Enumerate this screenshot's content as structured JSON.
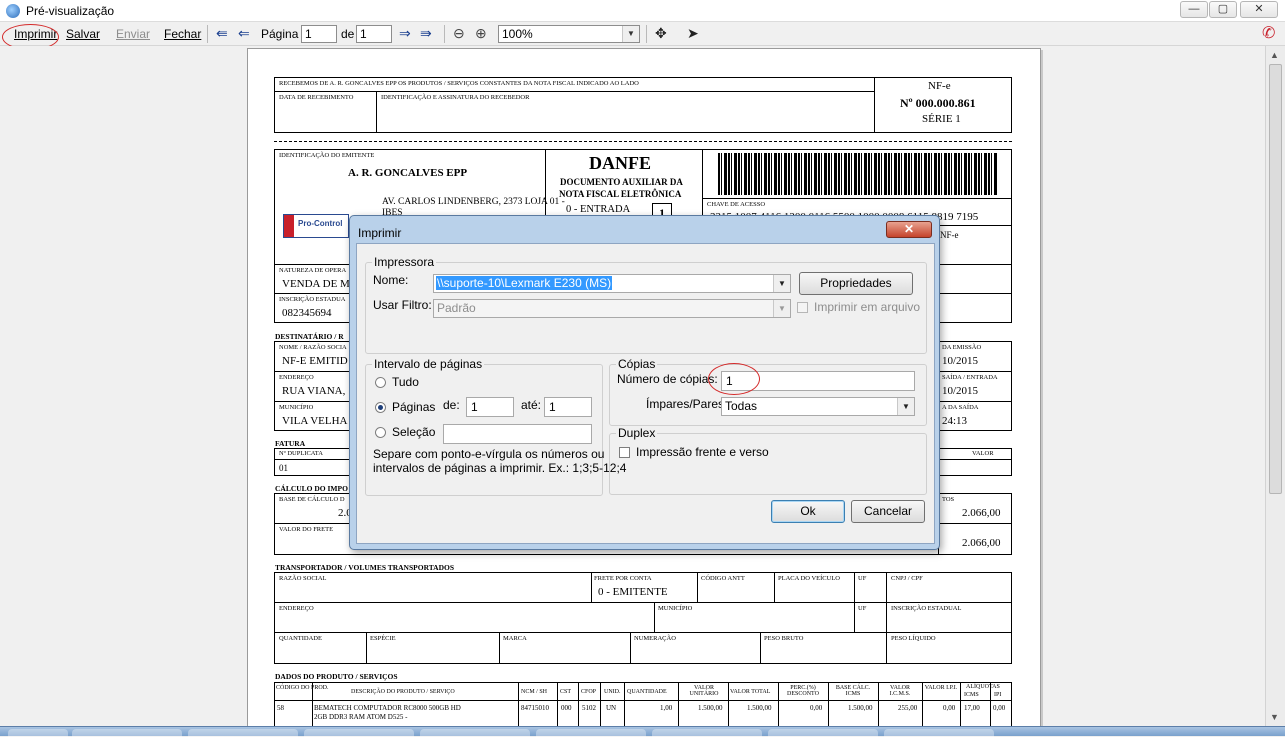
{
  "window": {
    "title": "Pré-visualização"
  },
  "toolbar": {
    "print": "Imprimir",
    "save": "Salvar",
    "send": "Enviar",
    "close": "Fechar",
    "page_label": "Página",
    "page_value": "1",
    "of_label": "de",
    "total_pages": "1",
    "zoom": "100%"
  },
  "danfe": {
    "receipt_text": "RECEBEMOS DE A. R. GONCALVES EPP OS PRODUTOS / SERVIÇOS CONSTANTES DA NOTA FISCAL INDICADO AO LADO",
    "receipt_date_label": "DATA DE RECEBIMENTO",
    "receipt_sign_label": "IDENTIFICAÇÃO E ASSINATURA DO RECEBEDOR",
    "nfe_label": "NF-e",
    "nfe_number": "Nº 000.000.861",
    "nfe_series": "SÉRIE 1",
    "emitter_label": "IDENTIFICAÇÃO DO EMITENTE",
    "emitter_name": "A. R. GONCALVES EPP",
    "emitter_address": "AV. CARLOS LINDENBERG, 2373 LOJA 01 -",
    "emitter_address2": "IBES",
    "logo_text": "Pro-Control",
    "danfe_title": "DANFE",
    "danfe_sub1": "DOCUMENTO AUXILIAR DA",
    "danfe_sub2": "NOTA FISCAL ELETRÔNICA",
    "entry_label": "0 - ENTRADA",
    "entry_box": "1",
    "access_key_label": "CHAVE DE ACESSO",
    "access_key": "3215 1007 4116 1200 0116 5500 1000 0008 6115 8819 7195",
    "nfe_side": "NF-e",
    "nature_label": "NATUREZA DE OPERA",
    "nature_value": "VENDA DE M",
    "state_reg_label": "INSCRIÇÃO ESTADUA",
    "state_reg_value": "082345694",
    "recipient_header": "DESTINATÁRIO / R",
    "recipient_name_label": "NOME / RAZÃO SOCIA",
    "recipient_name": "NF-E EMITID",
    "address_label": "ENDEREÇO",
    "address_value": "RUA VIANA,",
    "city_label": "MUNICÍPIO",
    "city_value": "VILA VELHA",
    "issue_label": "DA EMISSÃO",
    "issue_value": "10/2015",
    "exit_label": "SAÍDA / ENTRADA",
    "exit_value": "10/2015",
    "exit_time_label": "A DA SAÍDA",
    "exit_time_value": "24:13",
    "invoice_header": "FATURA",
    "dup_label": "Nº DUPLICATA",
    "dup_value": "01",
    "value_label": "VALOR",
    "tax_header": "CÁLCULO DO IMPO",
    "tax_base_label": "BASE DE CÁLCULO D",
    "tax_base_value": "2.0",
    "freight_label": "VALOR DO FRETE",
    "tos_label": "TOS",
    "total1": "2.066,00",
    "total2": "2.066,00",
    "carrier_header": "TRANSPORTADOR / VOLUMES TRANSPORTADOS",
    "carrier_name_label": "RAZÃO SOCIAL",
    "freight_paid_label": "FRETE POR CONTA",
    "freight_paid_value": "0 - EMITENTE",
    "antt_label": "CÓDIGO ANTT",
    "plate_label": "PLACA DO VEÍCULO",
    "uf_label": "UF",
    "cnpj_label": "CNPJ / CPF",
    "carrier_address_label": "ENDEREÇO",
    "carrier_city_label": "MUNICÍPIO",
    "carrier_uf_label": "UF",
    "carrier_ie_label": "INSCRIÇÃO ESTADUAL",
    "qty_label": "QUANTIDADE",
    "species_label": "ESPÉCIE",
    "brand_label": "MARCA",
    "numbering_label": "NUMERAÇÃO",
    "gross_label": "PESO BRUTO",
    "net_label": "PESO LÍQUIDO",
    "products_header": "DADOS DO PRODUTO / SERVIÇOS",
    "product_columns": [
      "CÓDIGO DO PROD.",
      "DESCRIÇÃO DO PRODUTO / SERVIÇO",
      "NCM / SH",
      "CST",
      "CFOP",
      "UNID.",
      "QUANTIDADE",
      "VALOR UNITÁRIO",
      "VALOR TOTAL",
      "PERC.(%) DESCONTO",
      "BASE CÁLC. ICMS",
      "VALOR I.C.M.S.",
      "VALOR I.P.I.",
      "ALÍQUOTAS ICMS IPI"
    ],
    "aliquotas_label": "ALÍQUOTAS",
    "aliq_icms": "ICMS",
    "aliq_ipi": "IPI",
    "product_row": {
      "code": "58",
      "description": "BEMATECH COMPUTADOR RC8000 500GB HD",
      "description2": "2GB DDR3 RAM ATOM D525 -",
      "ncm": "84715010",
      "cst": "000",
      "cfop": "5102",
      "unit": "UN",
      "qty": "1,00",
      "unit_price": "1.500,00",
      "total": "1.500,00",
      "discount": "0,00",
      "base_icms": "1.500,00",
      "icms": "255,00",
      "ipi": "0,00",
      "aliq_icms": "17,00",
      "aliq_ipi": "0,00"
    }
  },
  "dialog": {
    "title": "Imprimir",
    "close": "✕",
    "printer_group": "Impressora",
    "name_label": "Nome:",
    "name_value": "\\\\suporte-10\\Lexmark E230 (MS)",
    "properties_button": "Propriedades",
    "filter_label": "Usar Filtro:",
    "filter_value": "Padrão",
    "print_to_file": "Imprimir em arquivo",
    "range_group": "Intervalo de páginas",
    "all_label": "Tudo",
    "pages_label": "Páginas",
    "from_label": "de:",
    "from_value": "1",
    "to_label": "até:",
    "to_value": "1",
    "selection_label": "Seleção",
    "hint_line1": "Separe com ponto-e-vírgula os números ou",
    "hint_line2": "intervalos de páginas a imprimir. Ex.: 1;3;5-12;4",
    "copies_group": "Cópias",
    "copies_label": "Número de cópias:",
    "copies_value": "1",
    "odd_even_label": "Ímpares/Pares:",
    "odd_even_value": "Todas",
    "duplex_group": "Duplex",
    "duplex_label": "Impressão frente e verso",
    "ok_button": "Ok",
    "cancel_button": "Cancelar"
  },
  "colors": {
    "annotation": "#d42a2a",
    "selection": "#3399ff",
    "dialog_frame": "#b9d1ea"
  }
}
